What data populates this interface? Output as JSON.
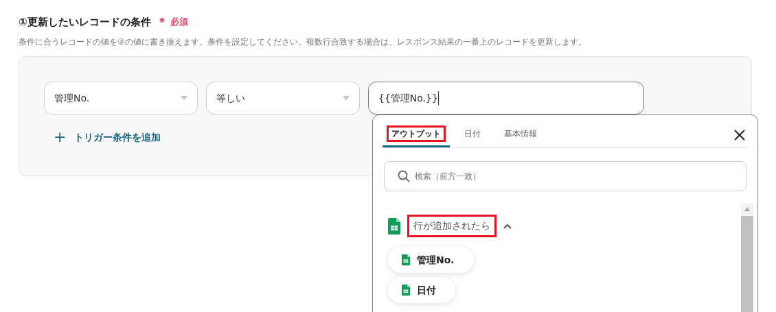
{
  "section": {
    "title": "①更新したいレコードの条件",
    "required_mark": "＊",
    "required_label": "必須",
    "description": "条件に合うレコードの値を②の値に書き換えます。条件を設定してください。複数行合致する場合は、レスポンス結果の一番上のレコードを更新します。"
  },
  "condition": {
    "field": "管理No.",
    "operator": "等しい",
    "value": "{{管理No.}}"
  },
  "add_condition": {
    "icon": "+",
    "label": "トリガー条件を追加"
  },
  "popup": {
    "tabs": [
      {
        "label": "アウトプット",
        "selected": true,
        "highlighted": true
      },
      {
        "label": "日付",
        "selected": false,
        "highlighted": false
      },
      {
        "label": "基本情報",
        "selected": false,
        "highlighted": false
      }
    ],
    "search": {
      "placeholder": "検索（前方一致）"
    },
    "group": {
      "label": "行が追加されたら",
      "highlighted": true,
      "expanded": true,
      "items": [
        {
          "label": "管理No."
        },
        {
          "label": "日付"
        }
      ]
    }
  }
}
